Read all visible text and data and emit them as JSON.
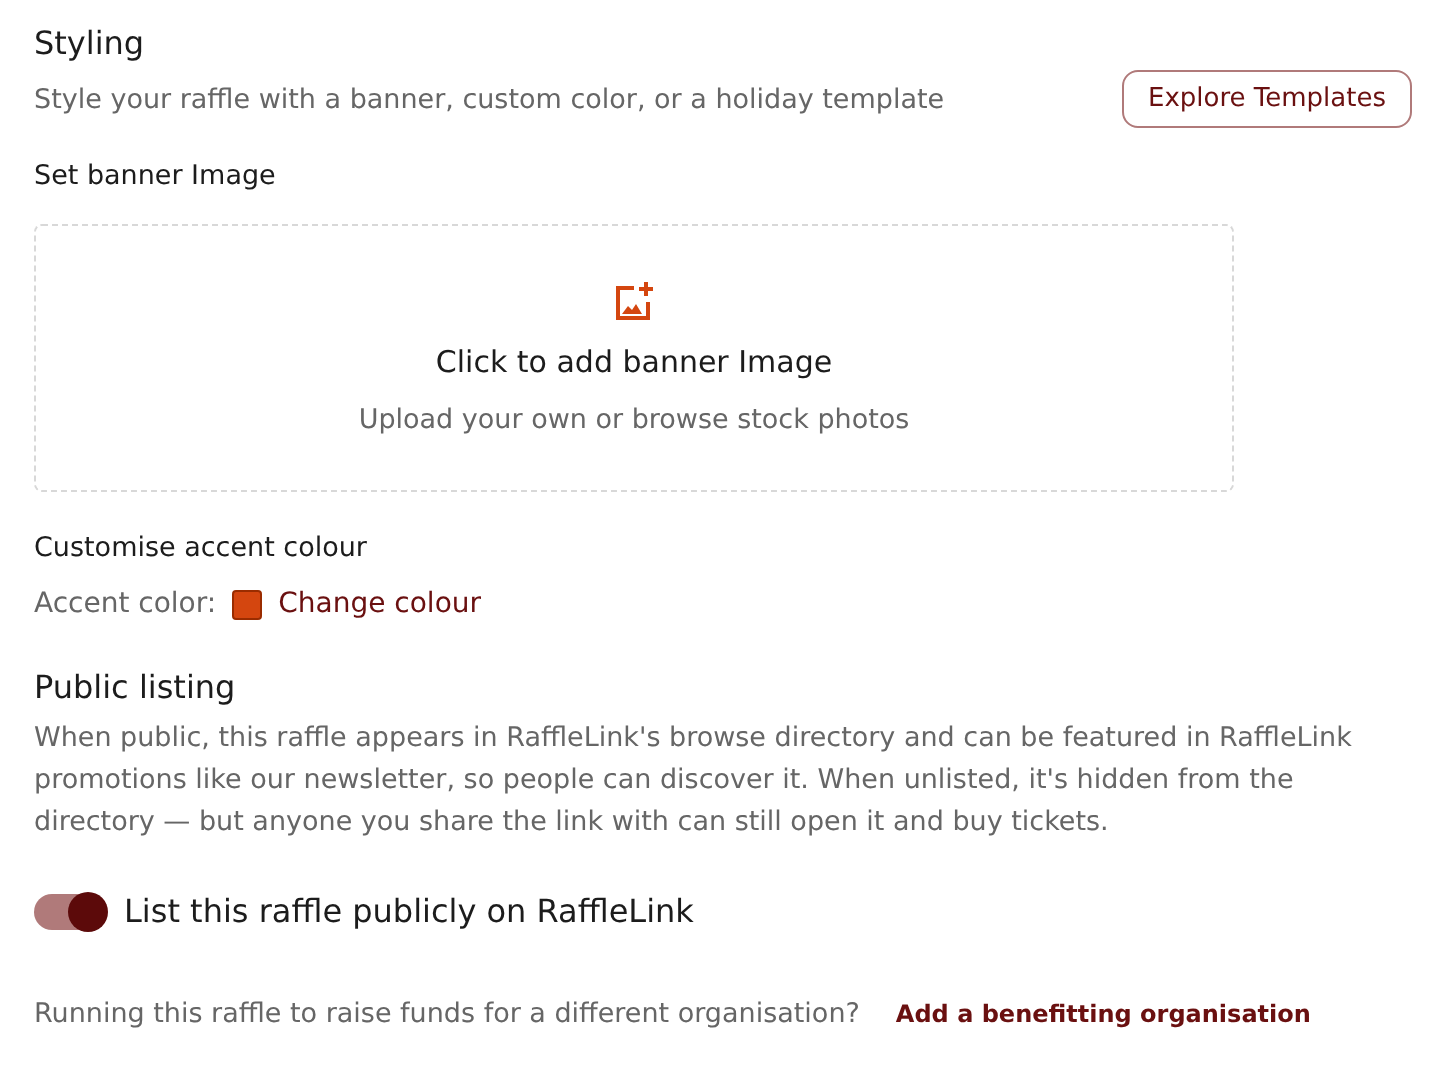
{
  "styling": {
    "title": "Styling",
    "subtitle": "Style your raffle with a banner, custom color, or a holiday template",
    "button": "Explore Templates"
  },
  "banner": {
    "label": "Set banner Image",
    "title": "Click to add banner Image",
    "hint": "Upload your own or browse stock photos"
  },
  "accent": {
    "label": "Customise accent colour",
    "prefix": "Accent color:",
    "color": "#d4460f",
    "link": "Change colour"
  },
  "public_listing": {
    "title": "Public listing",
    "description": "When public, this raffle appears in RaffleLink's browse directory and can be featured in RaffleLink promotions like our newsletter, so people can discover it. When unlisted, it's hidden from the directory — but anyone you share the link with can still open it and buy tickets.",
    "toggle": {
      "label": "List this raffle publicly on RaffleLink",
      "on": true
    }
  },
  "footer": {
    "question": "Running this raffle to raise funds for a different organisation?",
    "link": "Add a benefitting organisation"
  }
}
